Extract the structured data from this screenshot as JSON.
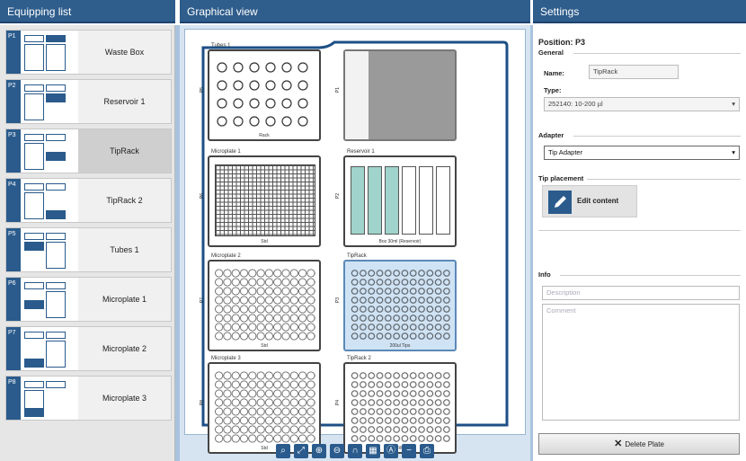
{
  "headers": {
    "equipping": "Equipping list",
    "graphical": "Graphical view",
    "settings": "Settings"
  },
  "equipping_list": [
    {
      "pos": "P1",
      "label": "Waste Box"
    },
    {
      "pos": "P2",
      "label": "Reservoir 1"
    },
    {
      "pos": "P3",
      "label": "TipRack"
    },
    {
      "pos": "P4",
      "label": "TipRack 2"
    },
    {
      "pos": "P5",
      "label": "Tubes 1"
    },
    {
      "pos": "P6",
      "label": "Microplate 1"
    },
    {
      "pos": "P7",
      "label": "Microplate 2"
    },
    {
      "pos": "P8",
      "label": "Microplate 3"
    }
  ],
  "deck": {
    "tubes": {
      "name": "Tubes 1",
      "side": "P5",
      "foot": "Rack"
    },
    "waste": {
      "side": "P1"
    },
    "micro1": {
      "name": "Microplate 1",
      "side": "P6",
      "foot": "Std"
    },
    "reservoir": {
      "name": "Reservoir 1",
      "side": "P2",
      "foot": "Box 30ml (Reservoir)"
    },
    "micro2": {
      "name": "Microplate 2",
      "side": "P7",
      "foot": "Std"
    },
    "tiprack": {
      "name": "TipRack",
      "side": "P3",
      "foot": "200ul Tips"
    },
    "micro3": {
      "name": "Microplate 3",
      "side": "P8",
      "foot": "Std"
    },
    "tiprack2": {
      "name": "TipRack 2",
      "side": "P4",
      "foot": "50ul Filtertips"
    }
  },
  "settings": {
    "position": "Position: P3",
    "general": "General",
    "name_label": "Name:",
    "name_value": "TipRack",
    "type_label": "Type:",
    "type_value": "252140: 10-200 µl",
    "adapter": "Adapter",
    "adapter_value": "Tip Adapter",
    "tip_placement": "Tip placement",
    "edit_content": "Edit content",
    "info": "Info",
    "description_placeholder": "Description",
    "comment_placeholder": "Comment",
    "delete": "Delete Plate"
  },
  "colors": {
    "header": "#2f5d8c",
    "accent": "#2a5b8c"
  }
}
